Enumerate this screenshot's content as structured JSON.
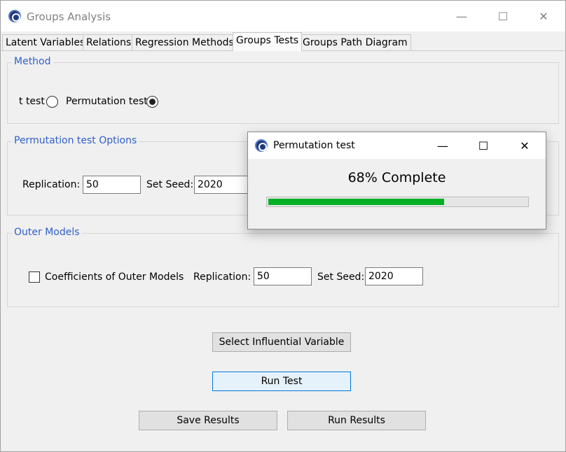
{
  "window": {
    "title": "Groups Analysis",
    "controls": {
      "minimize": "—",
      "maximize": "☐",
      "close": "✕"
    }
  },
  "tabs": [
    {
      "label": "Latent Variables"
    },
    {
      "label": "Relations"
    },
    {
      "label": "Regression Methods"
    },
    {
      "label": "Groups Tests",
      "active": true
    },
    {
      "label": "Groups Path Diagram"
    }
  ],
  "method": {
    "title": "Method",
    "t_test_label": "t test",
    "t_test_selected": false,
    "permutation_label": "Permutation test",
    "permutation_selected": true
  },
  "permutation_options": {
    "title": "Permutation test Options",
    "replication_label": "Replication:",
    "replication_value": "50",
    "seed_label": "Set Seed:",
    "seed_value": "2020"
  },
  "outer_models": {
    "title": "Outer Models",
    "coefficients_label": "Coefficients of Outer Models",
    "coefficients_checked": false,
    "replication_label": "Replication:",
    "replication_value": "50",
    "seed_label": "Set Seed:",
    "seed_value": "2020"
  },
  "buttons": {
    "select_influential": "Select Influential Variable",
    "run_test": "Run Test",
    "save_results": "Save Results",
    "run_results": "Run Results"
  },
  "popup": {
    "title": "Permutation test",
    "progress_text": "68% Complete",
    "progress_fraction": 0.68,
    "progress_color": "#06b025",
    "controls": {
      "minimize": "—",
      "maximize": "☐",
      "close": "✕"
    }
  }
}
